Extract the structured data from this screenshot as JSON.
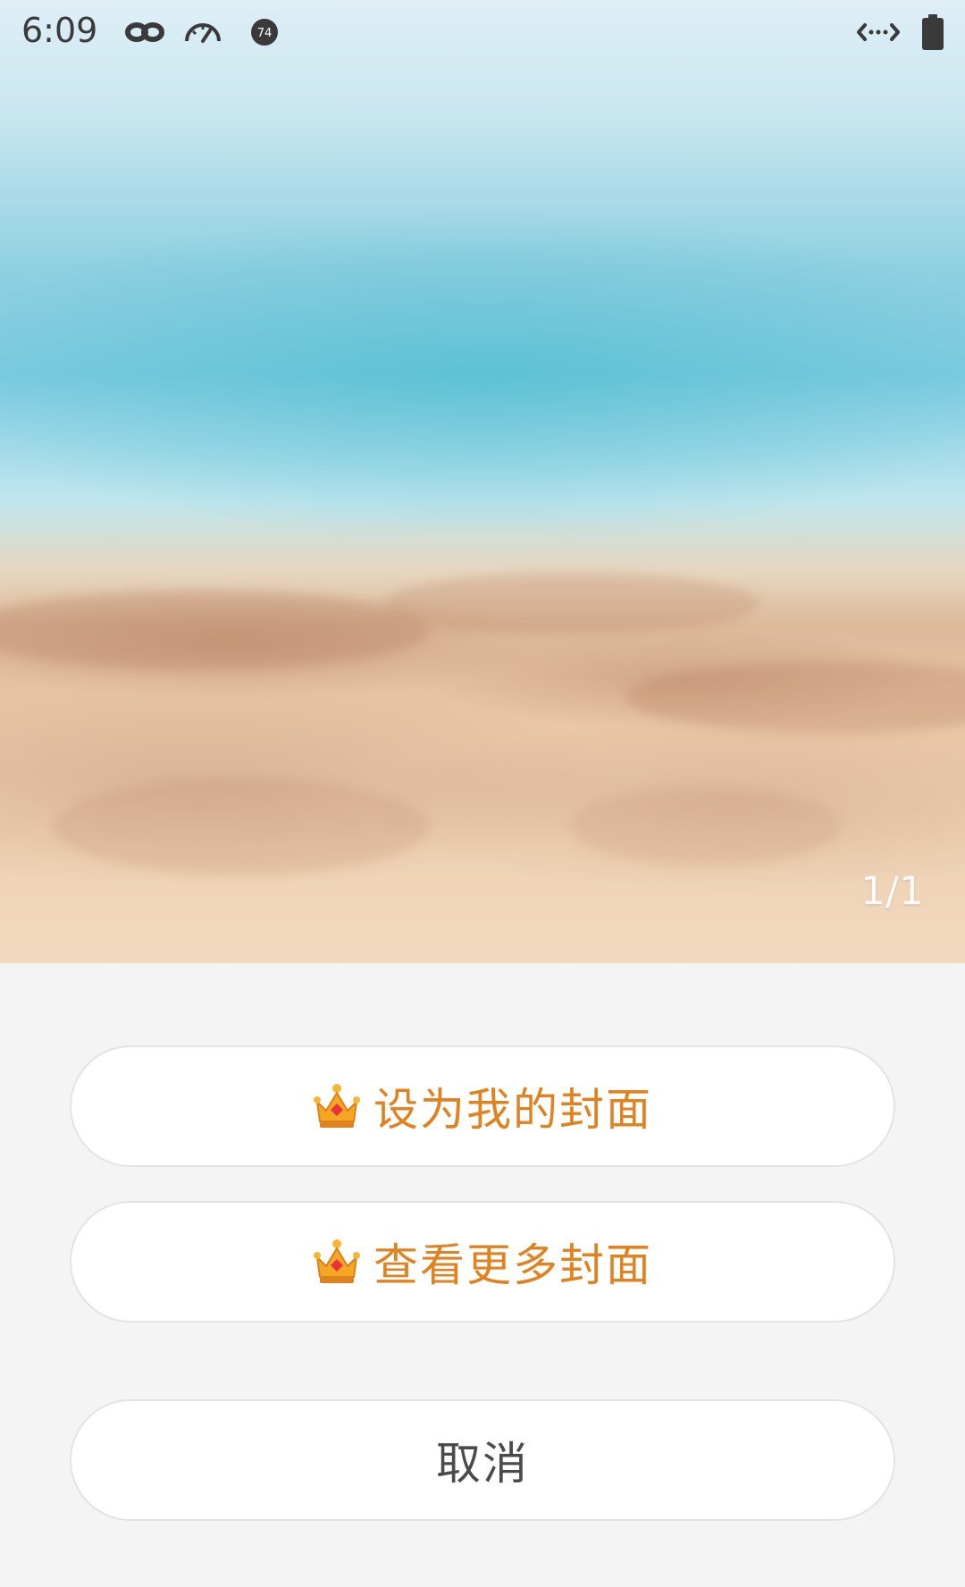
{
  "status_bar": {
    "time": "6:09",
    "icons": [
      "infinity-icon",
      "speedometer-icon",
      "badge-74-icon",
      "data-sync-icon",
      "battery-icon"
    ],
    "badge_number": "74"
  },
  "cover": {
    "page_indicator": "1/1"
  },
  "actions": {
    "set_cover_label": "设为我的封面",
    "more_covers_label": "查看更多封面",
    "cancel_label": "取消"
  },
  "colors": {
    "accent": "#e0821f",
    "crown": "#f5a623",
    "background": "#f4f4f4"
  }
}
